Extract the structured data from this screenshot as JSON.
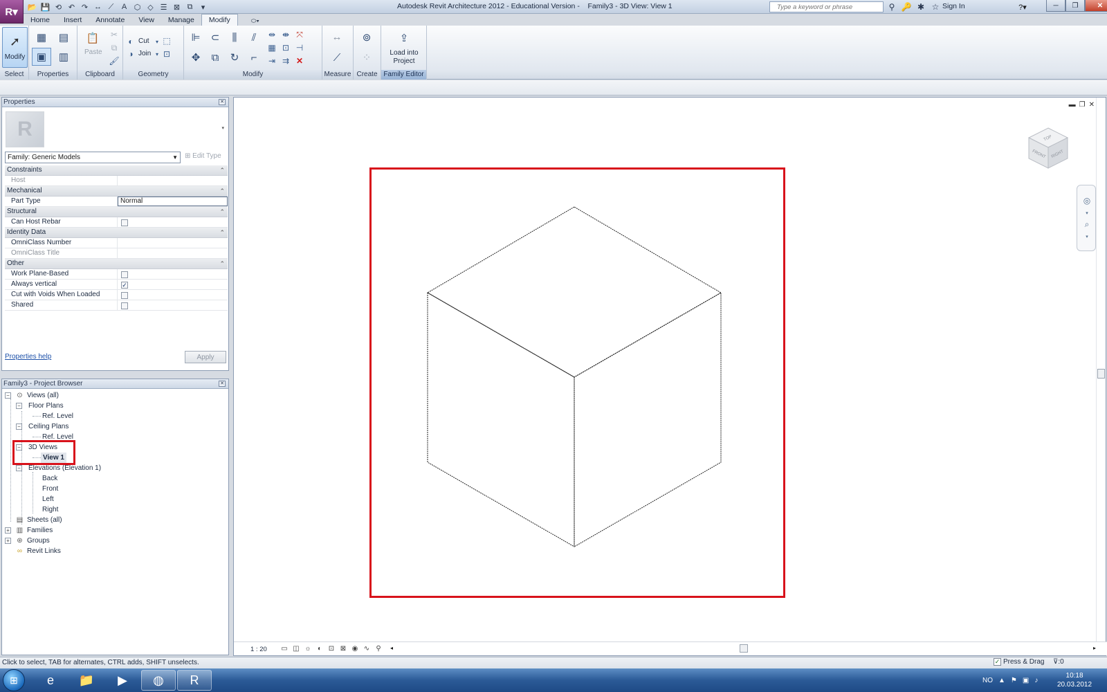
{
  "window": {
    "title": "Autodesk Revit Architecture 2012 - Educational Version -    Family3 - 3D View: View 1",
    "search_placeholder": "Type a keyword or phrase",
    "sign_in": "Sign In"
  },
  "tabs": [
    "Home",
    "Insert",
    "Annotate",
    "View",
    "Manage",
    "Modify"
  ],
  "ribbon": {
    "modify_label": "Modify",
    "paste_label": "Paste",
    "cut_label": "Cut",
    "join_label": "Join",
    "load_into_project": "Load into Project",
    "panels": [
      "Select",
      "Properties",
      "Clipboard",
      "Geometry",
      "Modify",
      "Measure",
      "Create",
      "Family Editor"
    ]
  },
  "properties": {
    "title": "Properties",
    "family_selector": "Family: Generic Models",
    "edit_type": "Edit Type",
    "groups": [
      {
        "name": "Constraints",
        "rows": [
          {
            "label": "Host",
            "value": ""
          }
        ]
      },
      {
        "name": "Mechanical",
        "rows": [
          {
            "label": "Part Type",
            "value": "Normal"
          }
        ]
      },
      {
        "name": "Structural",
        "rows": [
          {
            "label": "Can Host Rebar",
            "value": ""
          }
        ]
      },
      {
        "name": "Identity Data",
        "rows": [
          {
            "label": "OmniClass Number",
            "value": ""
          },
          {
            "label": "OmniClass Title",
            "value": ""
          }
        ]
      },
      {
        "name": "Other",
        "rows": [
          {
            "label": "Work Plane-Based",
            "value": ""
          },
          {
            "label": "Always vertical",
            "value": "✓"
          },
          {
            "label": "Cut with Voids When Loaded",
            "value": ""
          },
          {
            "label": "Shared",
            "value": ""
          }
        ]
      }
    ],
    "help_link": "Properties help",
    "apply": "Apply"
  },
  "browser": {
    "title": "Family3 - Project Browser",
    "nodes": {
      "views_all": "Views (all)",
      "floor_plans": "Floor Plans",
      "floor_ref": "Ref. Level",
      "ceiling_plans": "Ceiling Plans",
      "ceiling_ref": "Ref. Level",
      "views_3d": "3D Views",
      "view1": "View 1",
      "elevations": "Elevations (Elevation 1)",
      "back": "Back",
      "front": "Front",
      "left": "Left",
      "right": "Right",
      "sheets": "Sheets (all)",
      "families": "Families",
      "groups": "Groups",
      "revit_links": "Revit Links"
    }
  },
  "viewcube": {
    "top": "TOP",
    "front": "FRONT",
    "right": "RIGHT"
  },
  "view_control_bar": {
    "scale": "1 : 20"
  },
  "status": {
    "hint": "Click to select, TAB for alternates, CTRL adds, SHIFT unselects.",
    "press_drag": "Press & Drag",
    "filter": ":0"
  },
  "taskbar": {
    "language": "NO",
    "time": "10:18",
    "date": "20.03.2012"
  },
  "colors": {
    "highlight": "#d8121b",
    "app_button": "#7b2d77",
    "taskbar": "#2b5a97"
  }
}
